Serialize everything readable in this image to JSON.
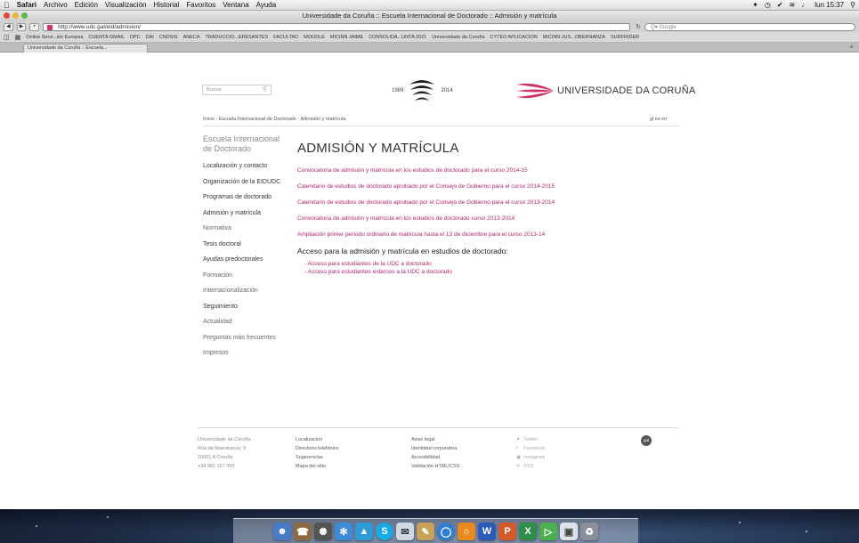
{
  "menubar": {
    "app": "Safari",
    "items": [
      "Archivo",
      "Edición",
      "Visualización",
      "Historial",
      "Favoritos",
      "Ventana",
      "Ayuda"
    ],
    "clock": "lun 15:37"
  },
  "window": {
    "title": "Universidade da Coruña :: Escuela Internacional de Doctorado :: Admisión y matrícula",
    "url": "http://www.udc.gal/eid/admision/",
    "search_placeholder": "Q▾ Google",
    "tab_title": "Universidade da Coruña :: Escuela...",
    "bookmarks": [
      "Online Servi...ión Europea",
      "CUENTA GMAIL",
      "DPC",
      "DAI",
      "CNDSIS",
      "ANECA",
      "TRADUCCIO...ERESANTES",
      "FACULTAD",
      "MOODLE",
      "MICINN JAIME",
      "CONSOLIDA...UNTA 2021",
      "Universidade da Coruña",
      "CYTED APLICACION",
      "MICINN JUS...OBERNANZA",
      "SURFRIDER"
    ]
  },
  "site": {
    "search_placeholder": "Buscar",
    "anniv_start": "1989",
    "anniv_end": "2014",
    "brand": "UNIVERSIDADE DA CORUÑA",
    "breadcrumb": "Inicio · Escuela Internacional de Doctorado · Admisión y matrícula",
    "languages": "gl es en"
  },
  "sidebar": {
    "title": "Escuela Internacional de Doctorado",
    "items": [
      "Localización y contacto",
      "Organización de la EIDUDC",
      "Programas de doctorado",
      "Admisión y matrícula",
      "Normativa",
      "Tesis doctoral",
      "Ayudas predoctorales",
      "Formación",
      "Internacionalización",
      "Seguimiento",
      "Actualidad",
      "Preguntas más frecuentes",
      "Impresos"
    ]
  },
  "main": {
    "title": "ADMISIÓN Y MATRÍCULA",
    "links": [
      "Convocatoria de admisión y matrícula en los estudios de doctorado para el curso 2014-15",
      "Calendario de estudios de doctorado aprobado por el Consejo de Gobierno para el curso 2014-2015",
      "Calendario de estudios de doctorado aprobado por el Consejo de Gobierno para el curso 2013-2014",
      "Convocatoria de admisión y matrícula en los estudios de doctorado curso 2013-2014",
      "Ampliación primer período ordinario de matrícula hasta el 13 de diciembre para el curso 2013-14"
    ],
    "access_title": "Acceso para la admisión y matrícula en estudios de doctorado:",
    "access_links": [
      "Acceso para estudiantes de la UDC a doctorado",
      "Acceso para estudiantes externos a la UDC a doctorado"
    ]
  },
  "footer": {
    "address": [
      "Universidade da Coruña",
      "Rúa da Maestranza, 9",
      "15001 A Coruña",
      "+34 981 167 000"
    ],
    "col2": [
      "Localización",
      "Directorio telefónico",
      "Sugerencias",
      "Mapa del sitio"
    ],
    "col3": [
      "Aviso legal",
      "Identidad corporativa",
      "Accesibilidad",
      "Validación HTML/CSS"
    ],
    "social": [
      "Twitter",
      "Facebook",
      "Instagram",
      "RSS"
    ],
    "badge": "gal"
  },
  "colors": {
    "accent": "#b4236a",
    "brand": "#d0306a"
  }
}
